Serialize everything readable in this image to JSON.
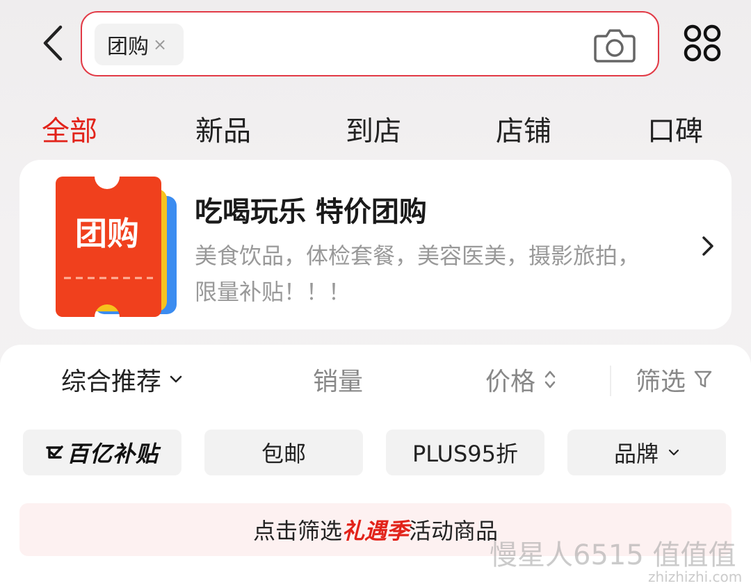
{
  "search": {
    "chip_label": "团购",
    "chip_close": "×"
  },
  "tabs": [
    {
      "label": "全部",
      "active": true
    },
    {
      "label": "新品"
    },
    {
      "label": "到店"
    },
    {
      "label": "店铺"
    },
    {
      "label": "口碑"
    }
  ],
  "promo": {
    "icon_text": "团购",
    "title": "吃喝玩乐  特价团购",
    "desc_line1": "美食饮品，体检套餐，美容医美，摄影旅拍，",
    "desc_line2": "限量补贴！！！"
  },
  "sort": {
    "comprehensive": "综合推荐",
    "sales": "销量",
    "price": "价格",
    "filter": "筛选"
  },
  "quick_filters": {
    "subsidy_logo": "百亿补贴",
    "free_shipping": "包邮",
    "plus": "PLUS95折",
    "brand": "品牌"
  },
  "notice": {
    "prefix": "点击筛选",
    "highlight": "礼遇季",
    "suffix": "活动商品"
  },
  "watermark": {
    "main": "慢星人6515 值值值",
    "sub": "zhizhizhi.com"
  },
  "colors": {
    "accent": "#e2231a",
    "search_border": "#e23a46"
  },
  "icons": [
    "back-arrow-icon",
    "camera-icon",
    "grid-menu-icon",
    "chevron-right-icon",
    "chevron-down-icon",
    "sort-updown-icon",
    "filter-funnel-icon"
  ]
}
